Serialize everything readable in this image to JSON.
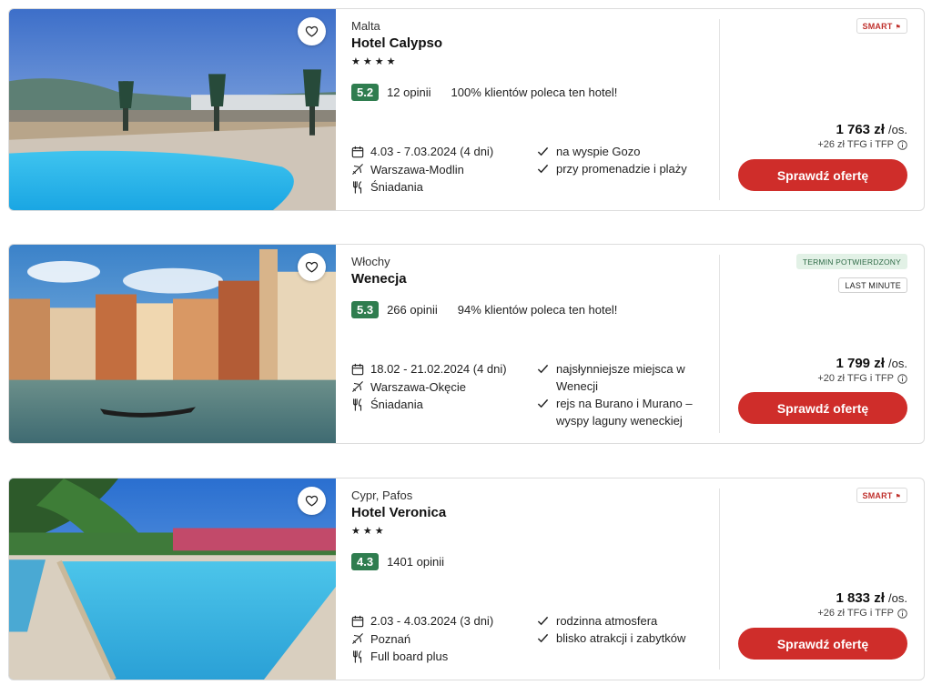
{
  "offers": [
    {
      "country": "Malta",
      "name": "Hotel Calypso",
      "stars": "★★★★",
      "score": "5.2",
      "reviews": "12 opinii",
      "recommend": "100% klientów poleca ten hotel!",
      "dates": "4.03 - 7.03.2024 (4 dni)",
      "departure": "Warszawa-Modlin",
      "board": "Śniadania",
      "features": [
        "na wyspie Gozo",
        "przy promenadzie i plaży"
      ],
      "badges": [
        "SMART"
      ],
      "price": "1 763 zł",
      "per": "/os.",
      "fees": "+26 zł TFG i TFP",
      "cta": "Sprawdź ofertę"
    },
    {
      "country": "Włochy",
      "name": "Wenecja",
      "stars": "",
      "score": "5.3",
      "reviews": "266 opinii",
      "recommend": "94% klientów poleca ten hotel!",
      "dates": "18.02 - 21.02.2024 (4 dni)",
      "departure": "Warszawa-Okęcie",
      "board": "Śniadania",
      "features": [
        "najsłynniejsze miejsca w Wenecji",
        "rejs na Burano i Murano – wyspy laguny weneckiej"
      ],
      "badges": [
        "TERMIN POTWIERDZONY",
        "LAST MINUTE"
      ],
      "price": "1 799 zł",
      "per": "/os.",
      "fees": "+20 zł TFG i TFP",
      "cta": "Sprawdź ofertę"
    },
    {
      "country": "Cypr, Pafos",
      "name": "Hotel Veronica",
      "stars": "★★★",
      "score": "4.3",
      "reviews": "1401 opinii",
      "recommend": "",
      "dates": "2.03 - 4.03.2024 (3 dni)",
      "departure": "Poznań",
      "board": "Full board plus",
      "features": [
        "rodzinna atmosfera",
        "blisko atrakcji i zabytków"
      ],
      "badges": [
        "SMART"
      ],
      "price": "1 833 zł",
      "per": "/os.",
      "fees": "+26 zł TFG i TFP",
      "cta": "Sprawdź ofertę"
    }
  ],
  "icons": {
    "favorite": "heart-icon",
    "dates": "calendar-icon",
    "flight": "plane-icon",
    "board": "fork-knife-icon",
    "feature": "check-icon",
    "info": "info-icon"
  },
  "colors": {
    "cta": "#cf2d2a",
    "score": "#2f7d4f",
    "smart_badge": "#c0312d",
    "termin_badge_bg": "#e2f1e6"
  }
}
